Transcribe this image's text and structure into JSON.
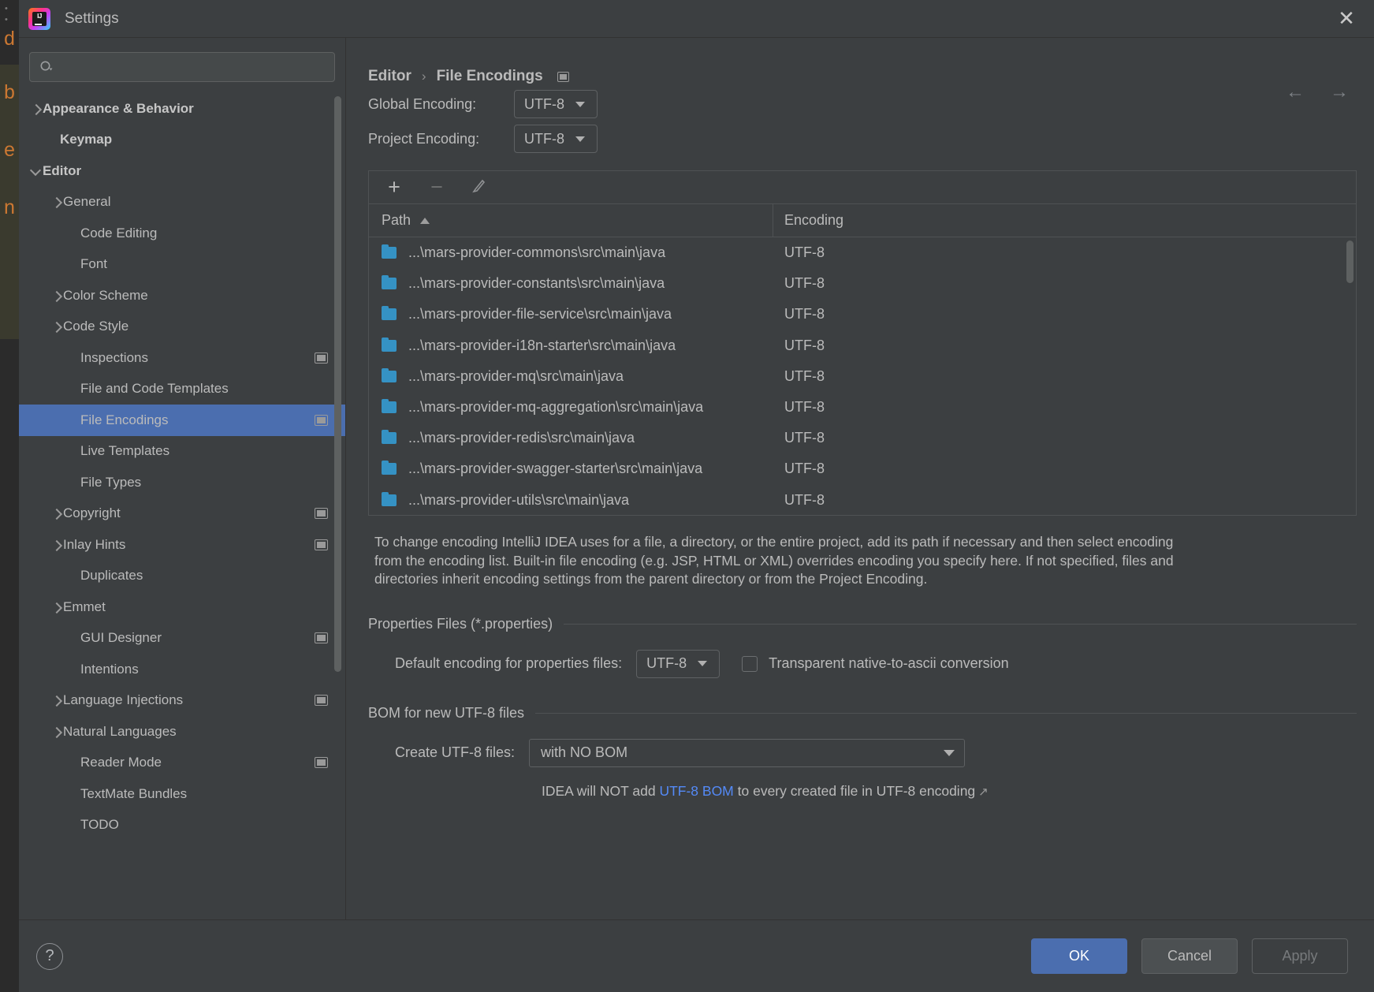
{
  "window": {
    "title": "Settings",
    "close_label": "✕",
    "logo_text": "IJ"
  },
  "search": {
    "value": "",
    "placeholder": ""
  },
  "sidebar": {
    "items": [
      {
        "label": "Appearance & Behavior",
        "arrow": "right",
        "bold": true,
        "indent": 30,
        "badge": false,
        "selected": false
      },
      {
        "label": "Keymap",
        "arrow": "none",
        "bold": true,
        "indent": 52,
        "badge": false,
        "selected": false
      },
      {
        "label": "Editor",
        "arrow": "down",
        "bold": true,
        "indent": 30,
        "badge": false,
        "selected": false
      },
      {
        "label": "General",
        "arrow": "right",
        "bold": false,
        "indent": 56,
        "badge": false,
        "selected": false
      },
      {
        "label": "Code Editing",
        "arrow": "none",
        "bold": false,
        "indent": 78,
        "badge": false,
        "selected": false
      },
      {
        "label": "Font",
        "arrow": "none",
        "bold": false,
        "indent": 78,
        "badge": false,
        "selected": false
      },
      {
        "label": "Color Scheme",
        "arrow": "right",
        "bold": false,
        "indent": 56,
        "badge": false,
        "selected": false
      },
      {
        "label": "Code Style",
        "arrow": "right",
        "bold": false,
        "indent": 56,
        "badge": false,
        "selected": false
      },
      {
        "label": "Inspections",
        "arrow": "none",
        "bold": false,
        "indent": 78,
        "badge": true,
        "selected": false
      },
      {
        "label": "File and Code Templates",
        "arrow": "none",
        "bold": false,
        "indent": 78,
        "badge": false,
        "selected": false
      },
      {
        "label": "File Encodings",
        "arrow": "none",
        "bold": false,
        "indent": 78,
        "badge": true,
        "selected": true
      },
      {
        "label": "Live Templates",
        "arrow": "none",
        "bold": false,
        "indent": 78,
        "badge": false,
        "selected": false
      },
      {
        "label": "File Types",
        "arrow": "none",
        "bold": false,
        "indent": 78,
        "badge": false,
        "selected": false
      },
      {
        "label": "Copyright",
        "arrow": "right",
        "bold": false,
        "indent": 56,
        "badge": true,
        "selected": false
      },
      {
        "label": "Inlay Hints",
        "arrow": "right",
        "bold": false,
        "indent": 56,
        "badge": true,
        "selected": false
      },
      {
        "label": "Duplicates",
        "arrow": "none",
        "bold": false,
        "indent": 78,
        "badge": false,
        "selected": false
      },
      {
        "label": "Emmet",
        "arrow": "right",
        "bold": false,
        "indent": 56,
        "badge": false,
        "selected": false
      },
      {
        "label": "GUI Designer",
        "arrow": "none",
        "bold": false,
        "indent": 78,
        "badge": true,
        "selected": false
      },
      {
        "label": "Intentions",
        "arrow": "none",
        "bold": false,
        "indent": 78,
        "badge": false,
        "selected": false
      },
      {
        "label": "Language Injections",
        "arrow": "right",
        "bold": false,
        "indent": 56,
        "badge": true,
        "selected": false
      },
      {
        "label": "Natural Languages",
        "arrow": "right",
        "bold": false,
        "indent": 56,
        "badge": false,
        "selected": false
      },
      {
        "label": "Reader Mode",
        "arrow": "none",
        "bold": false,
        "indent": 78,
        "badge": true,
        "selected": false
      },
      {
        "label": "TextMate Bundles",
        "arrow": "none",
        "bold": false,
        "indent": 78,
        "badge": false,
        "selected": false
      },
      {
        "label": "TODO",
        "arrow": "none",
        "bold": false,
        "indent": 78,
        "badge": false,
        "selected": false
      }
    ]
  },
  "breadcrumb": {
    "parent": "Editor",
    "separator": "›",
    "current": "File Encodings",
    "back_arrow": "←",
    "forward_arrow": "→"
  },
  "encodings": {
    "global_label": "Global Encoding:",
    "global_value": "UTF-8",
    "project_label": "Project Encoding:",
    "project_value": "UTF-8"
  },
  "table": {
    "toolbar": {
      "add": "+",
      "remove": "−",
      "edit": "edit-pencil"
    },
    "columns": [
      "Path",
      "Encoding"
    ],
    "sort_column": "Path",
    "sort_direction": "asc",
    "rows": [
      {
        "path": "...\\mars-provider-commons\\src\\main\\java",
        "encoding": "UTF-8"
      },
      {
        "path": "...\\mars-provider-constants\\src\\main\\java",
        "encoding": "UTF-8"
      },
      {
        "path": "...\\mars-provider-file-service\\src\\main\\java",
        "encoding": "UTF-8"
      },
      {
        "path": "...\\mars-provider-i18n-starter\\src\\main\\java",
        "encoding": "UTF-8"
      },
      {
        "path": "...\\mars-provider-mq\\src\\main\\java",
        "encoding": "UTF-8"
      },
      {
        "path": "...\\mars-provider-mq-aggregation\\src\\main\\java",
        "encoding": "UTF-8"
      },
      {
        "path": "...\\mars-provider-redis\\src\\main\\java",
        "encoding": "UTF-8"
      },
      {
        "path": "...\\mars-provider-swagger-starter\\src\\main\\java",
        "encoding": "UTF-8"
      },
      {
        "path": "...\\mars-provider-utils\\src\\main\\java",
        "encoding": "UTF-8"
      }
    ]
  },
  "description": "To change encoding IntelliJ IDEA uses for a file, a directory, or the entire project, add its path if necessary and then select encoding from the encoding list. Built-in file encoding (e.g. JSP, HTML or XML) overrides encoding you specify here. If not specified, files and directories inherit encoding settings from the parent directory or from the Project Encoding.",
  "properties_section": {
    "title": "Properties Files (*.properties)",
    "default_encoding_label": "Default encoding for properties files:",
    "default_encoding_value": "UTF-8",
    "transparent_label": "Transparent native-to-ascii conversion",
    "transparent_checked": false
  },
  "bom_section": {
    "title": "BOM for new UTF-8 files",
    "create_label": "Create UTF-8 files:",
    "create_value": "with NO BOM",
    "note_prefix": "IDEA will NOT add ",
    "note_link": "UTF-8 BOM",
    "note_suffix": " to every created file in UTF-8 encoding",
    "note_ext_arrow": "↗"
  },
  "footer": {
    "help_label": "?",
    "ok_label": "OK",
    "cancel_label": "Cancel",
    "apply_label": "Apply"
  },
  "background_editor": {
    "chars": [
      "d",
      "b",
      "e",
      "n"
    ]
  },
  "colors": {
    "accent": "#4b6eaf",
    "folder": "#3592c4",
    "link": "#548af7",
    "dialog_bg": "#3c3f41",
    "text": "#bbbbbb"
  }
}
